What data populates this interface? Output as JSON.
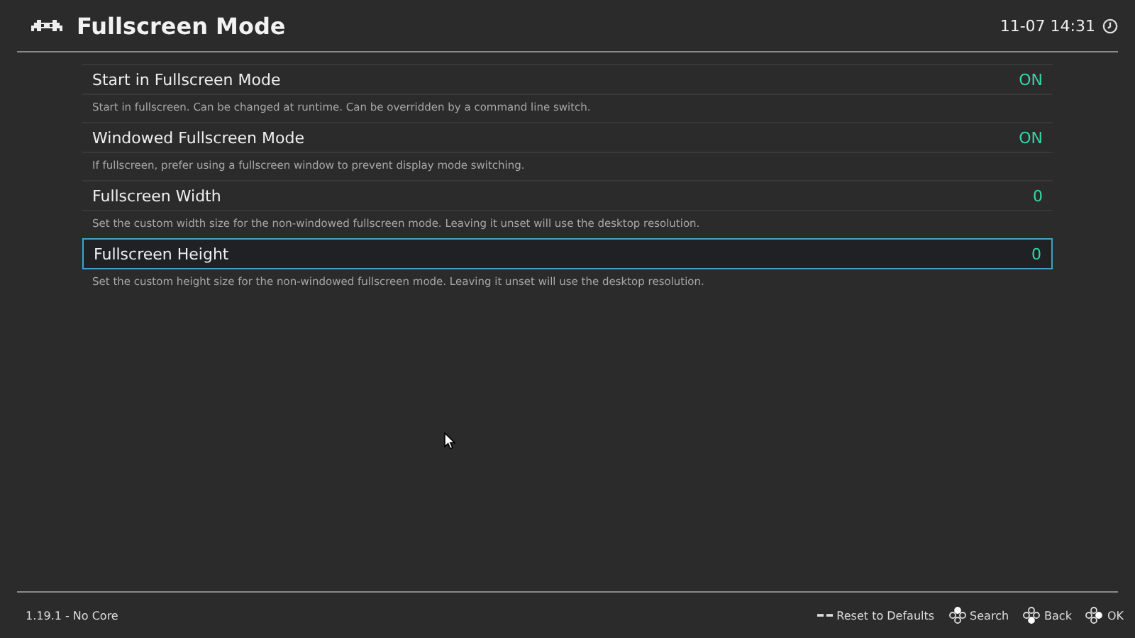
{
  "header": {
    "title": "Fullscreen Mode",
    "clock": "11-07 14:31"
  },
  "settings": [
    {
      "label": "Start in Fullscreen Mode",
      "value": "ON",
      "description": "Start in fullscreen. Can be changed at runtime. Can be overridden by a command line switch.",
      "selected": false
    },
    {
      "label": "Windowed Fullscreen Mode",
      "value": "ON",
      "description": "If fullscreen, prefer using a fullscreen window to prevent display mode switching.",
      "selected": false
    },
    {
      "label": "Fullscreen Width",
      "value": "0",
      "description": "Set the custom width size for the non-windowed fullscreen mode. Leaving it unset will use the desktop resolution.",
      "selected": false
    },
    {
      "label": "Fullscreen Height",
      "value": "0",
      "description": "Set the custom height size for the non-windowed fullscreen mode. Leaving it unset will use the desktop resolution.",
      "selected": true
    }
  ],
  "footer": {
    "version": "1.19.1 - No Core",
    "hints": [
      {
        "kind": "select",
        "label": "Reset to Defaults"
      },
      {
        "kind": "north",
        "label": "Search"
      },
      {
        "kind": "south",
        "label": "Back"
      },
      {
        "kind": "east",
        "label": "OK"
      }
    ]
  }
}
